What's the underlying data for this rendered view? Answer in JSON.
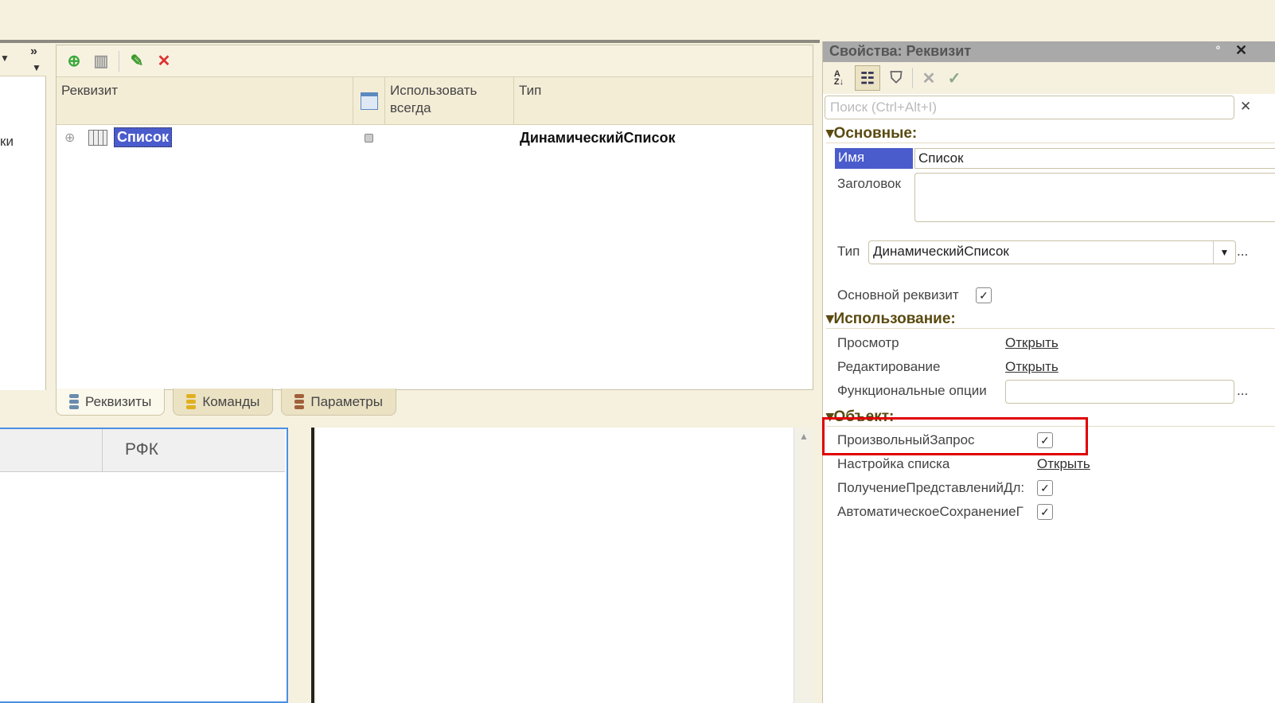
{
  "left_panel": {
    "partial_label": "ки",
    "expand": "»"
  },
  "toolbar": {
    "add": "add-icon",
    "add_column": "add-column-icon",
    "edit": "edit-icon",
    "delete": "delete-icon"
  },
  "table": {
    "headers": [
      "Реквизит",
      "Использовать всегда",
      "Тип"
    ],
    "rows": [
      {
        "name": "Список",
        "use_always": "",
        "type": "ДинамическийСписок"
      }
    ]
  },
  "tabs": [
    "Реквизиты",
    "Команды",
    "Параметры"
  ],
  "bottom": {
    "column": "РФК"
  },
  "properties": {
    "title": "Свойства: Реквизит",
    "pin": "ᵒ",
    "close": "✕",
    "search_placeholder": "Поиск (Ctrl+Alt+I)",
    "search_clear": "✕",
    "sections": {
      "main": "Основные:",
      "usage": "Использование:",
      "object": "Объект:"
    },
    "name_label": "Имя",
    "name_value": "Список",
    "caption_label": "Заголовок",
    "caption_value": "",
    "type_label": "Тип",
    "type_value": "ДинамическийСписок",
    "main_attr_label": "Основной реквизит",
    "view_label": "Просмотр",
    "edit_label": "Редактирование",
    "open": "Открыть",
    "func_options_label": "Функциональные опции",
    "ellipsis": "...",
    "custom_query_label": "ПроизвольныйЗапрос",
    "list_settings_label": "Настройка списка",
    "get_repr_label": "ПолучениеПредставленийДл:",
    "autosave_label": "АвтоматическоеСохранениеГ"
  },
  "colors": {
    "highlight": "#e00000",
    "selection": "#4a5ccc"
  }
}
